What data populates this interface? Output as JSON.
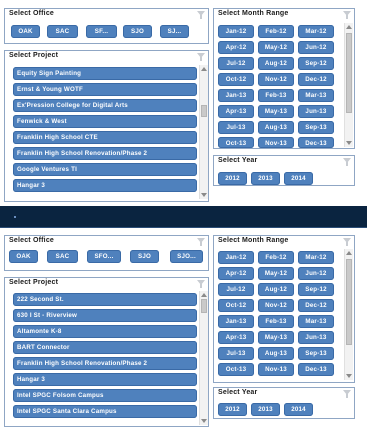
{
  "top": {
    "office": {
      "title": "Select Office",
      "items": [
        "OAK",
        "SAC",
        "SF...",
        "SJO",
        "SJ..."
      ]
    },
    "project": {
      "title": "Select Project",
      "items": [
        "Equity Sign Painting",
        "Ernst & Young WOTF",
        "Ex'Pression College for Digital Arts",
        "Fenwick & West",
        "Franklin High School CTE",
        "Franklin High School Renovation/Phase 2",
        "Google Ventures TI",
        "Hangar 3"
      ]
    },
    "month": {
      "title": "Select Month Range",
      "items": [
        "Jan-12",
        "Feb-12",
        "Mar-12",
        "Apr-12",
        "May-12",
        "Jun-12",
        "Jul-12",
        "Aug-12",
        "Sep-12",
        "Oct-12",
        "Nov-12",
        "Dec-12",
        "Jan-13",
        "Feb-13",
        "Mar-13",
        "Apr-13",
        "May-13",
        "Jun-13",
        "Jul-13",
        "Aug-13",
        "Sep-13",
        "Oct-13",
        "Nov-13",
        "Dec-13"
      ]
    },
    "year": {
      "title": "Select Year",
      "items": [
        "2012",
        "2013",
        "2014"
      ]
    }
  },
  "bottom": {
    "office": {
      "title": "Select Office",
      "items": [
        "OAK",
        "SAC",
        "SFO...",
        "SJO",
        "SJO..."
      ]
    },
    "project": {
      "title": "Select Project",
      "items": [
        "222 Second St.",
        "630 I St - Riverview",
        "Altamonte K-8",
        "BART Connector",
        "Franklin High School Renovation/Phase 2",
        "Hangar 3",
        "Intel SPGC Folsom Campus",
        "Intel SPGC Santa Clara Campus"
      ]
    },
    "month": {
      "title": "Select Month Range",
      "items": [
        "Jan-12",
        "Feb-12",
        "Mar-12",
        "Apr-12",
        "May-12",
        "Jun-12",
        "Jul-12",
        "Aug-12",
        "Sep-12",
        "Oct-12",
        "Nov-12",
        "Dec-12",
        "Jan-13",
        "Feb-13",
        "Mar-13",
        "Apr-13",
        "May-13",
        "Jun-13",
        "Jul-13",
        "Aug-13",
        "Sep-13",
        "Oct-13",
        "Nov-13",
        "Dec-13"
      ]
    },
    "year": {
      "title": "Select Year",
      "items": [
        "2012",
        "2013",
        "2014"
      ]
    }
  }
}
